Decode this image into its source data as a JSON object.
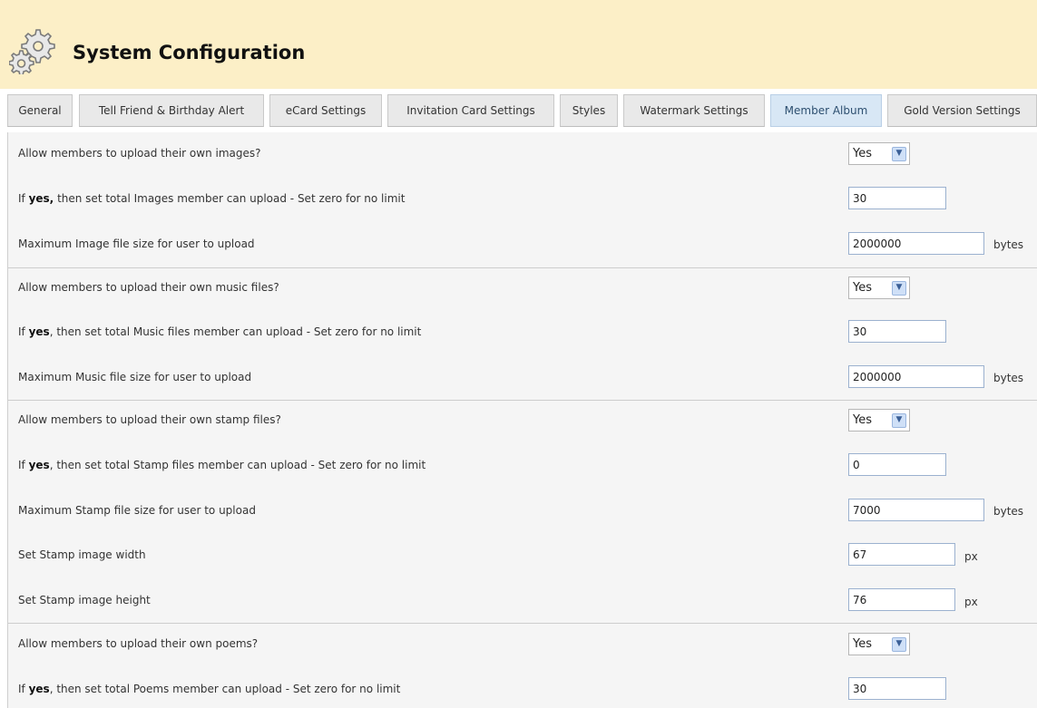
{
  "header": {
    "title": "System Configuration",
    "icon": "gears-icon"
  },
  "tabs": [
    {
      "label": "General",
      "active": false
    },
    {
      "label": "Tell Friend & Birthday Alert",
      "active": false
    },
    {
      "label": "eCard Settings",
      "active": false
    },
    {
      "label": "Invitation Card Settings",
      "active": false
    },
    {
      "label": "Styles",
      "active": false
    },
    {
      "label": "Watermark Settings",
      "active": false
    },
    {
      "label": "Member Album",
      "active": true
    },
    {
      "label": "Gold Version Settings",
      "active": false
    }
  ],
  "settings": {
    "images": {
      "allow_label": "Allow members to upload their own images?",
      "allow_value": "Yes",
      "limit_prefix": "If ",
      "limit_bold": "yes,",
      "limit_suffix": " then set total Images member can upload - Set zero for no limit",
      "limit_value": "30",
      "size_label": "Maximum Image file size for user to upload",
      "size_value": "2000000",
      "size_unit": "bytes"
    },
    "music": {
      "allow_label": "Allow members to upload their own music files?",
      "allow_value": "Yes",
      "limit_prefix": "If ",
      "limit_bold": "yes",
      "limit_suffix": ", then set total Music files member can upload - Set zero for no limit",
      "limit_value": "30",
      "size_label": "Maximum Music file size for user to upload",
      "size_value": "2000000",
      "size_unit": "bytes"
    },
    "stamp": {
      "allow_label": "Allow members to upload their own stamp files?",
      "allow_value": "Yes",
      "limit_prefix": "If ",
      "limit_bold": "yes",
      "limit_suffix": ", then set total Stamp files member can upload - Set zero for no limit",
      "limit_value": "0",
      "size_label": "Maximum Stamp file size for user to upload",
      "size_value": "7000",
      "size_unit": "bytes",
      "width_label": "Set Stamp image width",
      "width_value": "67",
      "width_unit": "px",
      "height_label": "Set Stamp image height",
      "height_value": "76",
      "height_unit": "px"
    },
    "poems": {
      "allow_label": "Allow members to upload their own poems?",
      "allow_value": "Yes",
      "limit_prefix": "If ",
      "limit_bold": "yes",
      "limit_suffix": ", then set total Poems member can upload - Set zero for no limit",
      "limit_value": "30"
    }
  }
}
